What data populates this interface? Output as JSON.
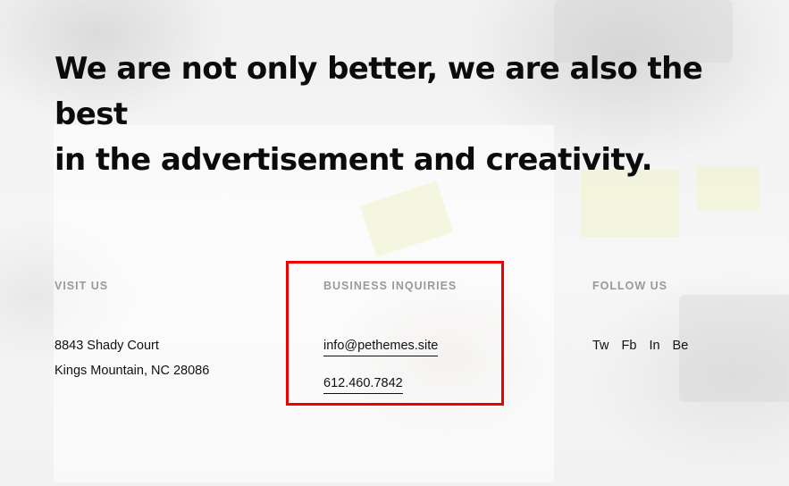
{
  "headline": {
    "line1": "We are not only better, we are also the best",
    "line2": "in the advertisement and creativity."
  },
  "visit": {
    "label": "VISIT US",
    "address_line1": "8843 Shady Court",
    "address_line2": "Kings Mountain, NC 28086"
  },
  "inquiries": {
    "label": "BUSINESS INQUIRIES",
    "email": "info@pethemes.site",
    "phone": "612.460.7842"
  },
  "follow": {
    "label": "FOLLOW US",
    "links": [
      "Tw",
      "Fb",
      "In",
      "Be"
    ]
  },
  "colors": {
    "highlight_border": "#ee0000",
    "label_gray": "#9a9a9a",
    "text": "#111111"
  }
}
